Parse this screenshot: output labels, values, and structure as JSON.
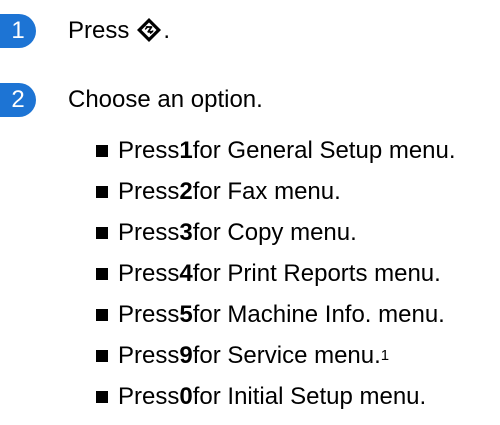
{
  "colors": {
    "step_badge": "#1d74d4",
    "text": "#000000"
  },
  "steps": [
    {
      "number": "1",
      "text": "Press",
      "icon": "menu-key-icon",
      "suffix": "."
    },
    {
      "number": "2",
      "text": "Choose an option."
    }
  ],
  "options": [
    {
      "prefix": "Press ",
      "key": "1",
      "text": " for General Setup menu."
    },
    {
      "prefix": "Press ",
      "key": "2",
      "text": " for Fax menu."
    },
    {
      "prefix": "Press ",
      "key": "3",
      "text": " for Copy menu."
    },
    {
      "prefix": "Press ",
      "key": "4",
      "text": " for Print Reports menu."
    },
    {
      "prefix": "Press ",
      "key": "5",
      "text": " for Machine Info. menu."
    },
    {
      "prefix": "Press ",
      "key": "9",
      "text": " for Service menu.",
      "footnote": "1"
    },
    {
      "prefix": "Press ",
      "key": "0",
      "text": " for Initial Setup menu."
    }
  ]
}
